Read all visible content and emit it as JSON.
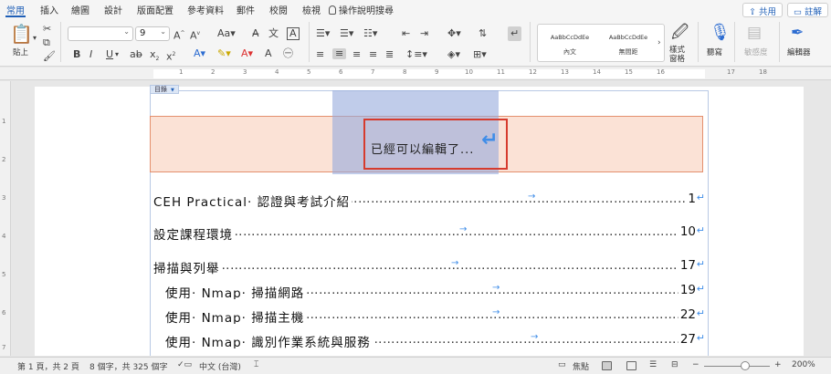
{
  "tabs": [
    "常用",
    "插入",
    "繪圖",
    "設計",
    "版面配置",
    "參考資料",
    "郵件",
    "校閱",
    "檢視"
  ],
  "tell_me": "操作說明搜尋",
  "share_label": "共用",
  "comments_label": "註解",
  "ribbon": {
    "paste_label": "貼上",
    "font_name": "",
    "font_size": "9",
    "styles": [
      {
        "preview": "AaBbCcDdEe",
        "name": "內文"
      },
      {
        "preview": "AaBbCcDdEe",
        "name": "無間距"
      }
    ],
    "styles_pane_label": "樣式\n窗格",
    "dictate_label": "聽寫",
    "sensitivity_label": "敏感度",
    "editor_label": "編輯器"
  },
  "ruler_numbers": [
    "1",
    "2",
    "3",
    "4",
    "5",
    "6",
    "7",
    "8",
    "9",
    "10",
    "11",
    "12",
    "13",
    "14",
    "15",
    "16",
    "17",
    "18"
  ],
  "vruler_numbers": [
    "1",
    "2",
    "3",
    "4",
    "5",
    "6",
    "7"
  ],
  "document": {
    "toc_tag": "目錄",
    "title": "已經可以編輯了...",
    "toc": [
      {
        "text": "CEH Practical· 認證與考試介紹",
        "page": "1",
        "indent": false
      },
      {
        "text": "設定課程環境",
        "page": "10",
        "indent": false
      },
      {
        "text": "掃描與列舉",
        "page": "17",
        "indent": false
      },
      {
        "text": "使用· Nmap· 掃描網路",
        "page": "19",
        "indent": true
      },
      {
        "text": "使用· Nmap· 掃描主機",
        "page": "22",
        "indent": true
      },
      {
        "text": "使用· Nmap· 識別作業系統與服務",
        "page": "27",
        "indent": true
      }
    ]
  },
  "status": {
    "page_info": "第 1 頁，共 2 頁",
    "word_count": "8 個字，共 325 個字",
    "language": "中文 (台灣)",
    "focus_label": "焦點",
    "zoom_level": "200%"
  }
}
